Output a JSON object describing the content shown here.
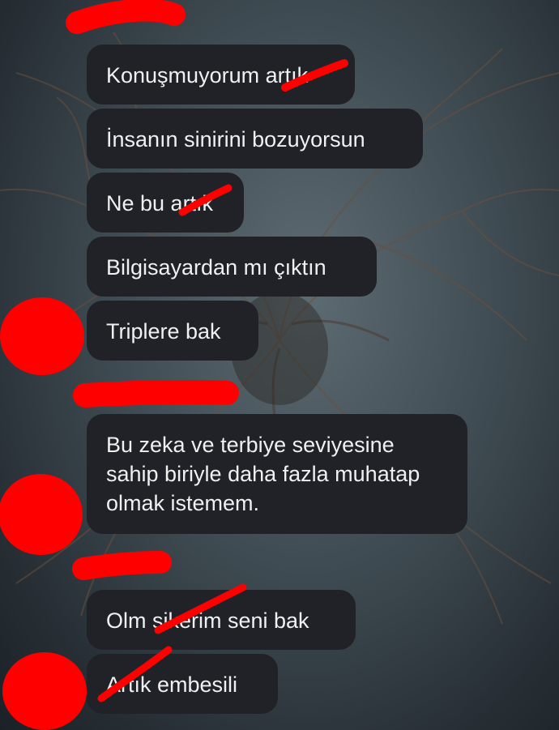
{
  "messages": [
    {
      "text": "Konuşmuyorum artık"
    },
    {
      "text": "İnsanın sinirini bozuyorsun"
    },
    {
      "text": "Ne bu artık"
    },
    {
      "text": "Bilgisayardan mı çıktın"
    },
    {
      "text": "Triplere bak"
    },
    {
      "text": "Bu zeka ve terbiye seviyesine sahip biriyle daha fazla muhatap olmak istemem."
    },
    {
      "text": "Olm sikerim seni bak"
    },
    {
      "text": "Artık embesili"
    }
  ],
  "colors": {
    "bubble_background": "#202227",
    "bubble_text": "#eef0f2",
    "redaction": "#ff0000"
  }
}
